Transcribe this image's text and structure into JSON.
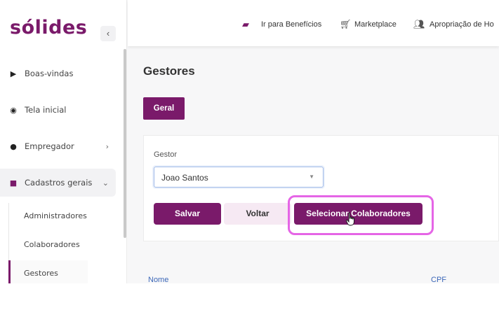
{
  "app": {
    "logo_text": "sólides",
    "brand_color": "#7a1a6a"
  },
  "sidebar": {
    "collapse_icon": "chevron-left-icon",
    "items": [
      {
        "label": "Boas-vindas",
        "icon": "play-icon"
      },
      {
        "label": "Tela inicial",
        "icon": "gauge-icon"
      },
      {
        "label": "Empregador",
        "icon": "user-circle-icon",
        "chevron": "›"
      },
      {
        "label": "Cadastros gerais",
        "icon": "square-icon",
        "chevron": "⌄"
      }
    ],
    "sub_items": [
      {
        "label": "Administradores"
      },
      {
        "label": "Colaboradores"
      },
      {
        "label": "Gestores"
      }
    ]
  },
  "topbar": {
    "links": [
      {
        "label": "Ir para Benefícios",
        "icon": "wallet-icon"
      },
      {
        "label": "Marketplace",
        "icon": "cart-icon"
      },
      {
        "label": "Apropriação de Ho",
        "icon": "users-icon"
      }
    ]
  },
  "main": {
    "title": "Gestores",
    "tab": "Geral",
    "form": {
      "gestor_label": "Gestor",
      "gestor_value": "Joao Santos"
    },
    "buttons": {
      "salvar": "Salvar",
      "voltar": "Voltar",
      "selecionar": "Selecionar Colaboradores"
    },
    "table": {
      "columns": [
        "Nome",
        "CPF"
      ]
    }
  }
}
